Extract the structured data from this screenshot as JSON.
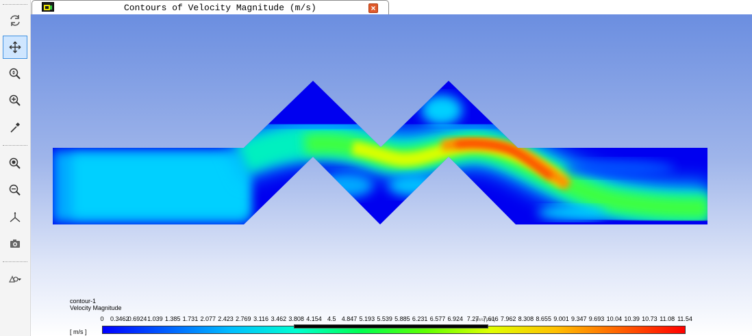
{
  "toolbar": {
    "items": [
      {
        "name": "rotate-view-button",
        "icon": "rotate-icon"
      },
      {
        "name": "pan-button",
        "icon": "pan-arrows-icon",
        "active": true
      },
      {
        "name": "zoom-in-out-button",
        "icon": "zoom-in-out-icon"
      },
      {
        "name": "zoom-to-area-button",
        "icon": "zoom-area-icon"
      },
      {
        "name": "probe-button",
        "icon": "probe-icon"
      },
      {
        "name": "fit-to-window-button",
        "icon": "fit-window-icon"
      },
      {
        "name": "zoom-out-button",
        "icon": "zoom-out-icon"
      },
      {
        "name": "axes-orientation-button",
        "icon": "axes-icon"
      },
      {
        "name": "save-picture-button",
        "icon": "camera-icon"
      },
      {
        "name": "view-options-dropdown",
        "icon": "view-settings-icon"
      }
    ]
  },
  "tab": {
    "title": "Contours of Velocity Magnitude (m/s)",
    "close_label": "×"
  },
  "legend": {
    "contour_name": "contour-1",
    "variable": "Velocity Magnitude",
    "unit": "[ m/s ]",
    "ticks": [
      "0",
      "0.3462",
      "0.6924",
      "1.039",
      "1.385",
      "1.731",
      "2.077",
      "2.423",
      "2.769",
      "3.116",
      "3.462",
      "3.808",
      "4.154",
      "4.5",
      "4.847",
      "5.193",
      "5.539",
      "5.885",
      "6.231",
      "6.577",
      "6.924",
      "7.27",
      "7.616",
      "7.962",
      "8.308",
      "8.655",
      "9.001",
      "9.347",
      "9.693",
      "10.04",
      "10.39",
      "10.73",
      "11.08",
      "11.54"
    ],
    "slider_label": "[m/s] [m/s]",
    "colormap": [
      "#0000ff",
      "#0060ff",
      "#00c0ff",
      "#00ffd0",
      "#00ff50",
      "#60ff00",
      "#e0ff00",
      "#ffc000",
      "#ff6000",
      "#ff0000"
    ]
  },
  "colors": {
    "background_top": "#6b8ee0",
    "background_bottom": "#ffffff",
    "active_tool": "#cfe6ff"
  }
}
